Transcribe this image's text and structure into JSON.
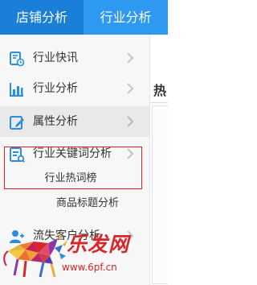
{
  "tabs": {
    "shop_analysis": "店铺分析",
    "industry_analysis": "行业分析"
  },
  "sidebar": {
    "items": [
      {
        "label": "行业快讯",
        "icon": "news-icon"
      },
      {
        "label": "行业分析",
        "icon": "bar-chart-icon"
      },
      {
        "label": "属性分析",
        "icon": "edit-icon"
      },
      {
        "label": "行业关键词分析",
        "icon": "keyword-icon"
      },
      {
        "label": "流失客户分析",
        "icon": "user-icon"
      }
    ],
    "subitems": [
      {
        "label": "行业热词榜"
      },
      {
        "label": "商品标题分析"
      }
    ]
  },
  "content": {
    "heading": "热"
  },
  "watermark": {
    "brand": "乐发网",
    "url": "www.6pf.cn"
  },
  "colors": {
    "tab_bar": "#1e86e0",
    "icon_blue": "#2b8de0",
    "highlight": "#e02020",
    "watermark": "#d8262a"
  }
}
